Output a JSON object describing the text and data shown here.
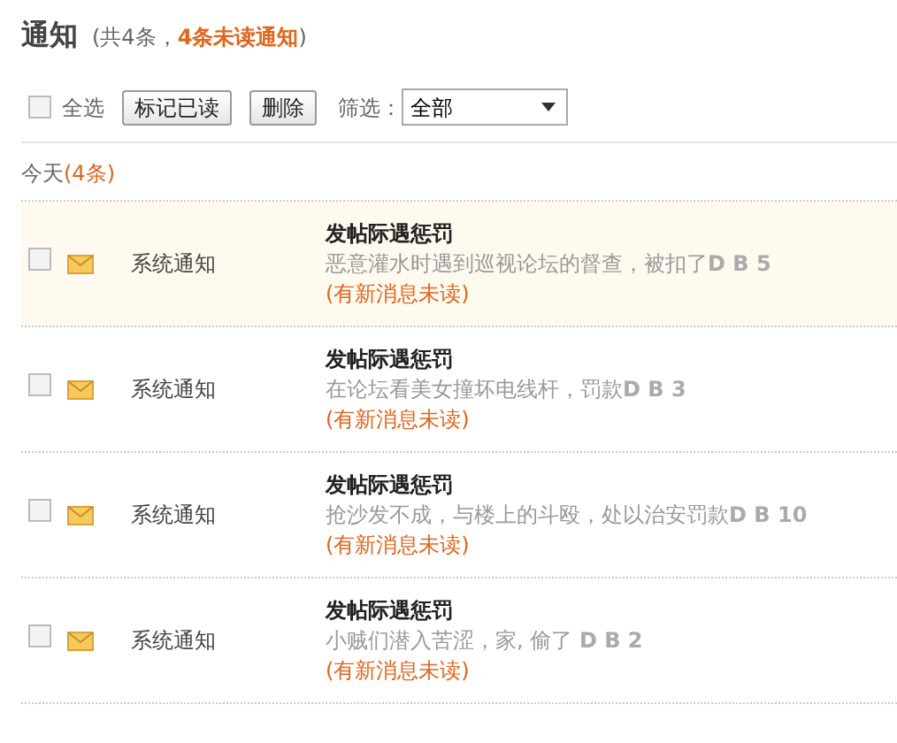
{
  "header": {
    "title": "通知",
    "summary_open": "(共4条，",
    "unread_count": "4条未读通知",
    "summary_close": ")"
  },
  "toolbar": {
    "select_all": {
      "label": "全选",
      "checked": false
    },
    "buttons": [
      "标记已读",
      "删除"
    ],
    "filter": {
      "label": "筛选：",
      "value": "全部"
    }
  },
  "group": {
    "label": "今天",
    "count": "(4条)"
  },
  "notices": [
    {
      "checked": false,
      "selected": true,
      "sender": "系统通知",
      "title": "发帖际遇惩罚",
      "body": "恶意灌水时遇到巡视论坛的督查，被扣了**D B 5**",
      "status": "(有新消息未读)"
    },
    {
      "checked": false,
      "selected": false,
      "sender": "系统通知",
      "title": "发帖际遇惩罚",
      "body": "在论坛看美女撞坏电线杆，罚款**D B 3**",
      "status": "(有新消息未读)"
    },
    {
      "checked": false,
      "selected": false,
      "sender": "系统通知",
      "title": "发帖际遇惩罚",
      "body": "抢沙发不成，与楼上的斗殴，处以治安罚款**D B 10**",
      "status": "(有新消息未读)"
    },
    {
      "checked": false,
      "selected": false,
      "sender": "系统通知",
      "title": "发帖际遇惩罚",
      "body": "小贼们潜入苦涩，家, 偷了 **D B 2**",
      "status": "(有新消息未读)"
    }
  ]
}
